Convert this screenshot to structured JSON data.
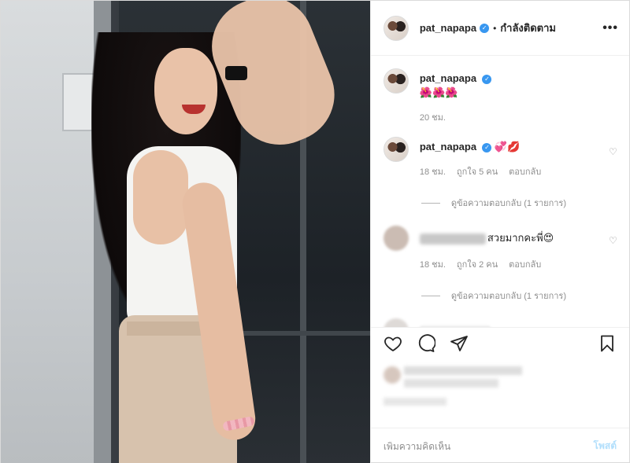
{
  "header": {
    "username": "pat_napapa",
    "separator": "•",
    "follow_status": "กำลังติดตาม",
    "more_icon": "more-options-icon"
  },
  "comments": [
    {
      "username": "pat_napapa",
      "text": "🌺🌺🌺",
      "time": "20 ชม.",
      "verified": true
    },
    {
      "username": "pat_napapa",
      "text": "💞💋",
      "time": "18 ชม.",
      "likes": "ถูกใจ 5 คน",
      "reply": "ตอบกลับ",
      "view_replies": "ดูข้อความตอบกลับ (1 รายการ)",
      "verified": true
    },
    {
      "username_blurred": true,
      "text": "สวยมากคะพี่😍",
      "time": "18 ชม.",
      "likes": "ถูกใจ 2 คน",
      "reply": "ตอบกลับ",
      "view_replies": "ดูข้อความตอบกลับ (1 รายการ)"
    }
  ],
  "actions": {
    "like_icon": "heart-icon",
    "comment_icon": "comment-icon",
    "share_icon": "share-icon",
    "save_icon": "bookmark-icon"
  },
  "add_comment": {
    "placeholder": "เพิ่มความคิดเห็น",
    "post_label": "โพสต์"
  },
  "colors": {
    "accent": "#3897f0",
    "post_button_disabled": "#b2dffc",
    "secondary_text": "#8e8e8e"
  }
}
